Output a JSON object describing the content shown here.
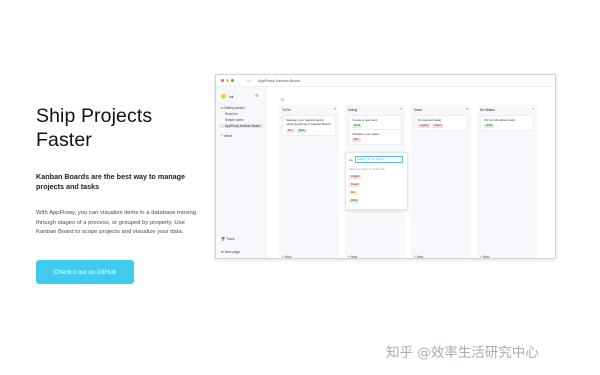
{
  "hero": {
    "title": "Ship Projects Faster",
    "subtitle": "Kanban Boards are the best way to manage projects and tasks",
    "description": "With AppFlowy, you can visualize items in a database moving through stages of a process, or grouped by property. Use Kanban Board to scope projects and visualize your data.",
    "cta_label": "Check it out on GitHub"
  },
  "app": {
    "window_title": "AppFlowy Kanban Board",
    "toolbar_back": "<>",
    "sidebar": {
      "user": "lok",
      "section": "▾ Getting started",
      "items": [
        "Read me",
        "Simple notes",
        "AppFlowy Kanban Board"
      ],
      "add_section": "+ Views",
      "trash": "Trash",
      "new_page": "New page"
    },
    "board_tools": "☰",
    "columns": [
      {
        "name": "To Do",
        "new_label": "+ New",
        "cards": [
          {
            "title": "Manage your tasks/projects using AppFlowy's Kanban Board",
            "tags": [
              {
                "label": "Fun",
                "color": "#ffd9e3"
              },
              {
                "label": "Work",
                "color": "#d7f2dc"
              }
            ]
          }
        ]
      },
      {
        "name": "Doing",
        "new_label": "+ New",
        "cards": [
          {
            "title": "Create a new card",
            "tags": [
              {
                "label": "Work",
                "color": "#d7f2dc"
              }
            ]
          },
          {
            "title": "Visualize your tasks",
            "tags": [
              {
                "label": "Fun",
                "color": "#ffd9e3"
              }
            ]
          }
        ]
      },
      {
        "name": "Done",
        "new_label": "+ New",
        "cards": [
          {
            "title": "[Completed task]",
            "tags": [
              {
                "label": "Urgent",
                "color": "#ffd9e3"
              },
              {
                "label": "Travel",
                "color": "#ffd9e3"
              }
            ]
          }
        ]
      },
      {
        "name": "No Status",
        "new_label": "+ New",
        "cards": [
          {
            "title": "[To be scheduled task]",
            "tags": [
              {
                "label": "Work",
                "color": "#d7f2dc"
              }
            ]
          }
        ]
      }
    ],
    "popover": {
      "field_icon": "Aa",
      "search_placeholder": "Search for an option",
      "hint": "Select an option or create one",
      "options": [
        {
          "label": "Urgent",
          "color": "#ffd9e3"
        },
        {
          "label": "Travel",
          "color": "#ffe0cc"
        },
        {
          "label": "Fun",
          "color": "#fff1b8"
        },
        {
          "label": "Work",
          "color": "#d7f2dc"
        }
      ],
      "option_more": "›"
    }
  },
  "watermark": "知乎 @效率生活研究中心",
  "colors": {
    "cta": "#3ecbed",
    "accent": "#50b7f3"
  }
}
